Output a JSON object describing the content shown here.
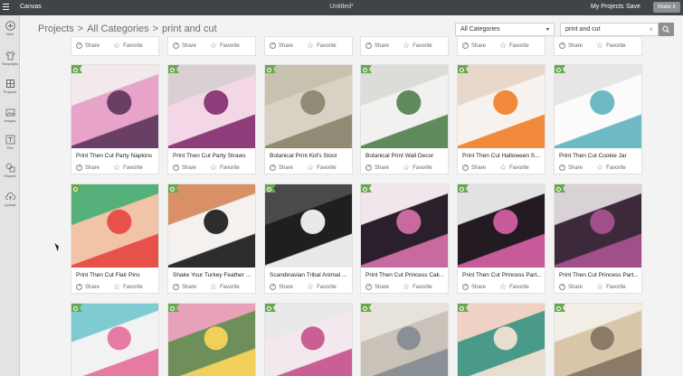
{
  "topbar": {
    "app_name": "Canvas",
    "document_title": "Untitled*",
    "my_projects": "My Projects",
    "save": "Save",
    "make_it": "Make It"
  },
  "sidebar": {
    "items": [
      {
        "label": "New",
        "icon": "plus-icon"
      },
      {
        "label": "Templates",
        "icon": "shirt-icon"
      },
      {
        "label": "Projects",
        "icon": "projects-icon"
      },
      {
        "label": "Images",
        "icon": "image-icon"
      },
      {
        "label": "Text",
        "icon": "text-icon"
      },
      {
        "label": "Shapes",
        "icon": "shapes-icon"
      },
      {
        "label": "Upload",
        "icon": "upload-icon"
      }
    ]
  },
  "breadcrumb": {
    "root": "Projects",
    "category": "All Categories",
    "query": "print and cut",
    "separator": ">"
  },
  "filter": {
    "category_value": "All Categories",
    "caret": "▾"
  },
  "search": {
    "value": "print and cut",
    "clear": "×"
  },
  "actions": {
    "share": "Share",
    "favorite": "Favorite"
  },
  "rows": [
    {
      "cards": [
        {
          "title": ""
        },
        {
          "title": ""
        },
        {
          "title": ""
        },
        {
          "title": ""
        },
        {
          "title": ""
        },
        {
          "title": ""
        }
      ]
    },
    {
      "cards": [
        {
          "title": "Print Then Cut Party Napkins",
          "colors": [
            "#e8a3c9",
            "#6a3f66",
            "#f1e9ec"
          ]
        },
        {
          "title": "Print Then Cut Party Straws",
          "colors": [
            "#f3d7e6",
            "#8e3c7a",
            "#d9d0d4"
          ]
        },
        {
          "title": "Botanical Print Kid's Stool",
          "colors": [
            "#d7d2c4",
            "#8f8b74",
            "#c7c1b0"
          ]
        },
        {
          "title": "Botanical Print Wall Decor",
          "colors": [
            "#f1f1ef",
            "#5f8a5b",
            "#dcdcd8"
          ]
        },
        {
          "title": "Print Then Cut Halloween Sti...",
          "colors": [
            "#f7f2ee",
            "#f08a3a",
            "#e8d8cc"
          ]
        },
        {
          "title": "Print Then Cut Cookie Jar",
          "colors": [
            "#fbfbfb",
            "#6fb9c7",
            "#e6e6e6"
          ]
        }
      ]
    },
    {
      "cards": [
        {
          "title": "Print Then Cut Flair Pins",
          "colors": [
            "#f1c4a8",
            "#e8504a",
            "#56b07a"
          ]
        },
        {
          "title": "Shake Your Turkey Feather A...",
          "colors": [
            "#f4f1ee",
            "#2d2d2d",
            "#d99066"
          ]
        },
        {
          "title": "Scandinavian Tribal Animal ...",
          "colors": [
            "#1f1f1f",
            "#e9e9e9",
            "#4a4a4a"
          ]
        },
        {
          "title": "Print Then Cut Princess Cak...",
          "colors": [
            "#2a1f2a",
            "#c66aa0",
            "#f1e6ec"
          ]
        },
        {
          "title": "Print Then Cut Princess Part...",
          "colors": [
            "#231a22",
            "#c75b9a",
            "#e2e2e2"
          ]
        },
        {
          "title": "Print Then Cut Princess Part...",
          "colors": [
            "#3c2a3b",
            "#a04f88",
            "#d8d2d6"
          ]
        }
      ]
    },
    {
      "cards": [
        {
          "title": "",
          "colors": [
            "#f2f2f2",
            "#e67aa3",
            "#7ecbd1"
          ]
        },
        {
          "title": "",
          "colors": [
            "#6f8f5a",
            "#f0cf5a",
            "#e7a1b8"
          ]
        },
        {
          "title": "",
          "colors": [
            "#f3e8ee",
            "#c95f94",
            "#e9e9e9"
          ]
        },
        {
          "title": "",
          "colors": [
            "#c9c2b8",
            "#8a8f95",
            "#e7e2dc"
          ]
        },
        {
          "title": "",
          "colors": [
            "#4a9a8a",
            "#e8ded0",
            "#f0d2c5"
          ]
        },
        {
          "title": "",
          "colors": [
            "#d9c6a8",
            "#8a7a66",
            "#f2ede5"
          ]
        }
      ]
    }
  ]
}
